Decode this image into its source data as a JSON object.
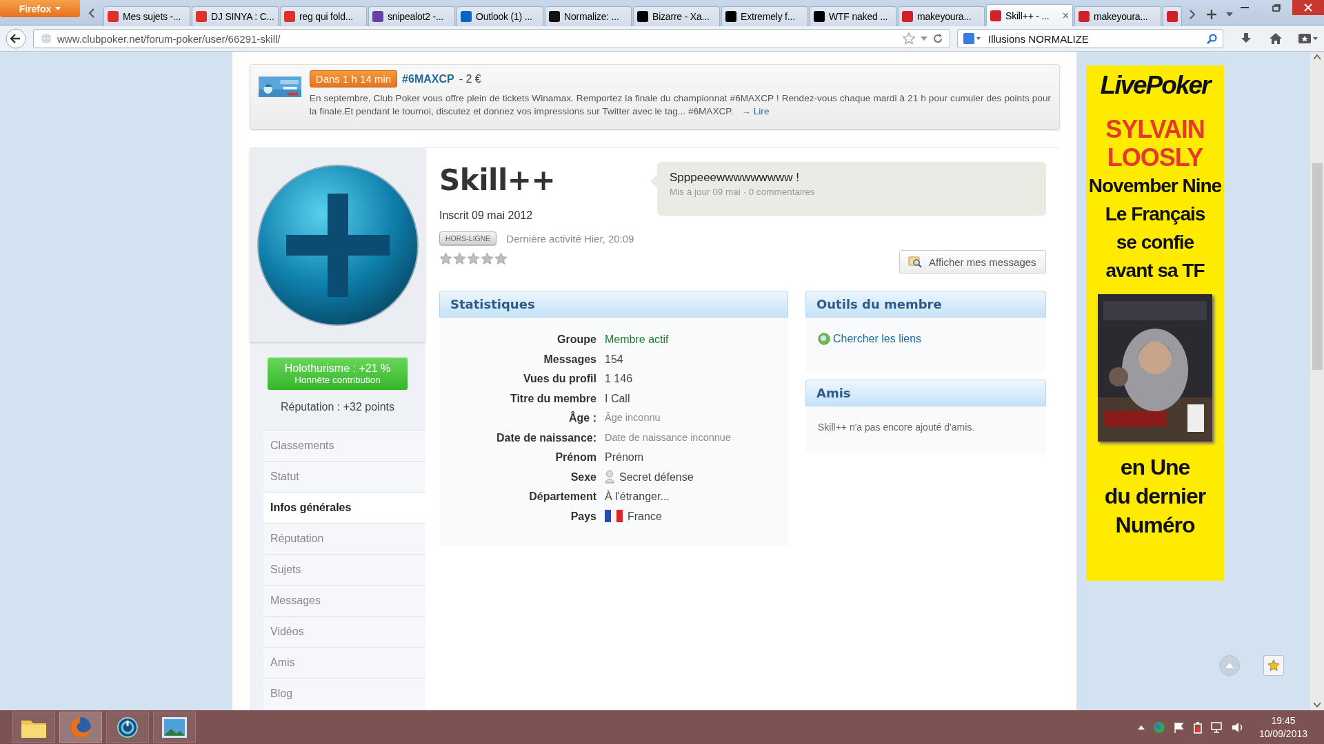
{
  "browser": {
    "menu_button": "Firefox",
    "tabs": [
      {
        "label": "Mes sujets -...",
        "color": "#e0302a",
        "selected": false
      },
      {
        "label": "DJ SINYA : C...",
        "color": "#e0302a",
        "selected": false
      },
      {
        "label": "reg qui fold...",
        "color": "#e0302a",
        "selected": false
      },
      {
        "label": "snipealot2 -...",
        "color": "#6441a5",
        "selected": false
      },
      {
        "label": "Outlook (1) ...",
        "color": "#0a64c8",
        "selected": false
      },
      {
        "label": "Normalize: ...",
        "color": "#111111",
        "selected": false
      },
      {
        "label": "Bizarre - Xa...",
        "color": "#000000",
        "selected": false
      },
      {
        "label": "Extremely f...",
        "color": "#000000",
        "selected": false
      },
      {
        "label": "WTF naked ...",
        "color": "#000000",
        "selected": false
      },
      {
        "label": "makeyoura...",
        "color": "#d0202a",
        "selected": false
      },
      {
        "label": "Skill++ - ...",
        "color": "#d0202a",
        "selected": true
      },
      {
        "label": "makeyoura...",
        "color": "#d0202a",
        "selected": false
      },
      {
        "color": "#d0202a",
        "selected": false
      }
    ],
    "tab_close": "×",
    "url": "www.clubpoker.net/forum-poker/user/66291-skill/",
    "search": "Illusions NORMALIZE"
  },
  "banner": {
    "countdown": "Dans 1 h 14 min",
    "title": "#6MAXCP",
    "price": "- 2 €",
    "text": "En septembre, Club Poker vous offre plein de tickets Winamax. Remportez la finale du championnat #6MAXCP ! Rendez-vous chaque mardi à 21 h pour cumuler des points pour la finale.Et pendant le tournoi, discutez et donnez vos impressions sur Twitter avec le tag... #6MAXCP.",
    "link": "→ Lire"
  },
  "profile": {
    "name": "Skill++",
    "joined": "Inscrit 09 mai 2012",
    "status": "HORS-LIGNE",
    "last_activity": "Dernière activité Hier, 20:09",
    "stars": 0,
    "status_message": {
      "text": "Spppeeewwwwwwwww !",
      "meta": "Mis à jour 09 mai · 0 commentaires"
    },
    "messages_button": "Afficher mes messages",
    "reputation_badge": {
      "title": "Holothurisme : +21 %",
      "subtitle": "Honnête contribution"
    },
    "reputation": "Réputation : +32 points"
  },
  "sidebar": {
    "items": [
      {
        "label": "Classements",
        "selected": false
      },
      {
        "label": "Statut",
        "selected": false
      },
      {
        "label": "Infos générales",
        "selected": true
      },
      {
        "label": "Réputation",
        "selected": false
      },
      {
        "label": "Sujets",
        "selected": false
      },
      {
        "label": "Messages",
        "selected": false
      },
      {
        "label": "Vidéos",
        "selected": false
      },
      {
        "label": "Amis",
        "selected": false
      },
      {
        "label": "Blog",
        "selected": false
      }
    ]
  },
  "statistics": {
    "title": "Statistiques",
    "rows": [
      {
        "label": "Groupe",
        "value": "Membre actif",
        "kind": "link"
      },
      {
        "label": "Messages",
        "value": "154",
        "kind": "text"
      },
      {
        "label": "Vues du profil",
        "value": "1 146",
        "kind": "text"
      },
      {
        "label": "Titre du membre",
        "value": "I Call",
        "kind": "text"
      },
      {
        "label": "Âge :",
        "value": "Âge inconnu",
        "kind": "muted"
      },
      {
        "label": "Date de naissance:",
        "value": "Date de naissance inconnue",
        "kind": "muted"
      },
      {
        "label": "Prénom",
        "value": "Prénom",
        "kind": "text"
      },
      {
        "label": "Sexe",
        "value": "Secret défense",
        "kind": "gender"
      },
      {
        "label": "Département",
        "value": "À l'étranger...",
        "kind": "text"
      },
      {
        "label": "Pays",
        "value": "France",
        "kind": "flag"
      }
    ]
  },
  "member_tools": {
    "title": "Outils du membre",
    "link": "Chercher les liens"
  },
  "friends": {
    "title": "Amis",
    "text": "Skill++ n'a pas encore ajouté d'amis."
  },
  "ad": {
    "logo": "LivePoker",
    "headline": [
      "SYLVAIN",
      "LOOSLY"
    ],
    "lines": [
      "November Nine",
      "Le Français",
      "se confie",
      "avant sa TF"
    ],
    "picture": {
      "kind": "picture"
    },
    "footer": [
      "en Une",
      "du dernier",
      "Numéro"
    ]
  },
  "taskbar": {
    "time": "19:45",
    "date": "10/09/2013"
  }
}
